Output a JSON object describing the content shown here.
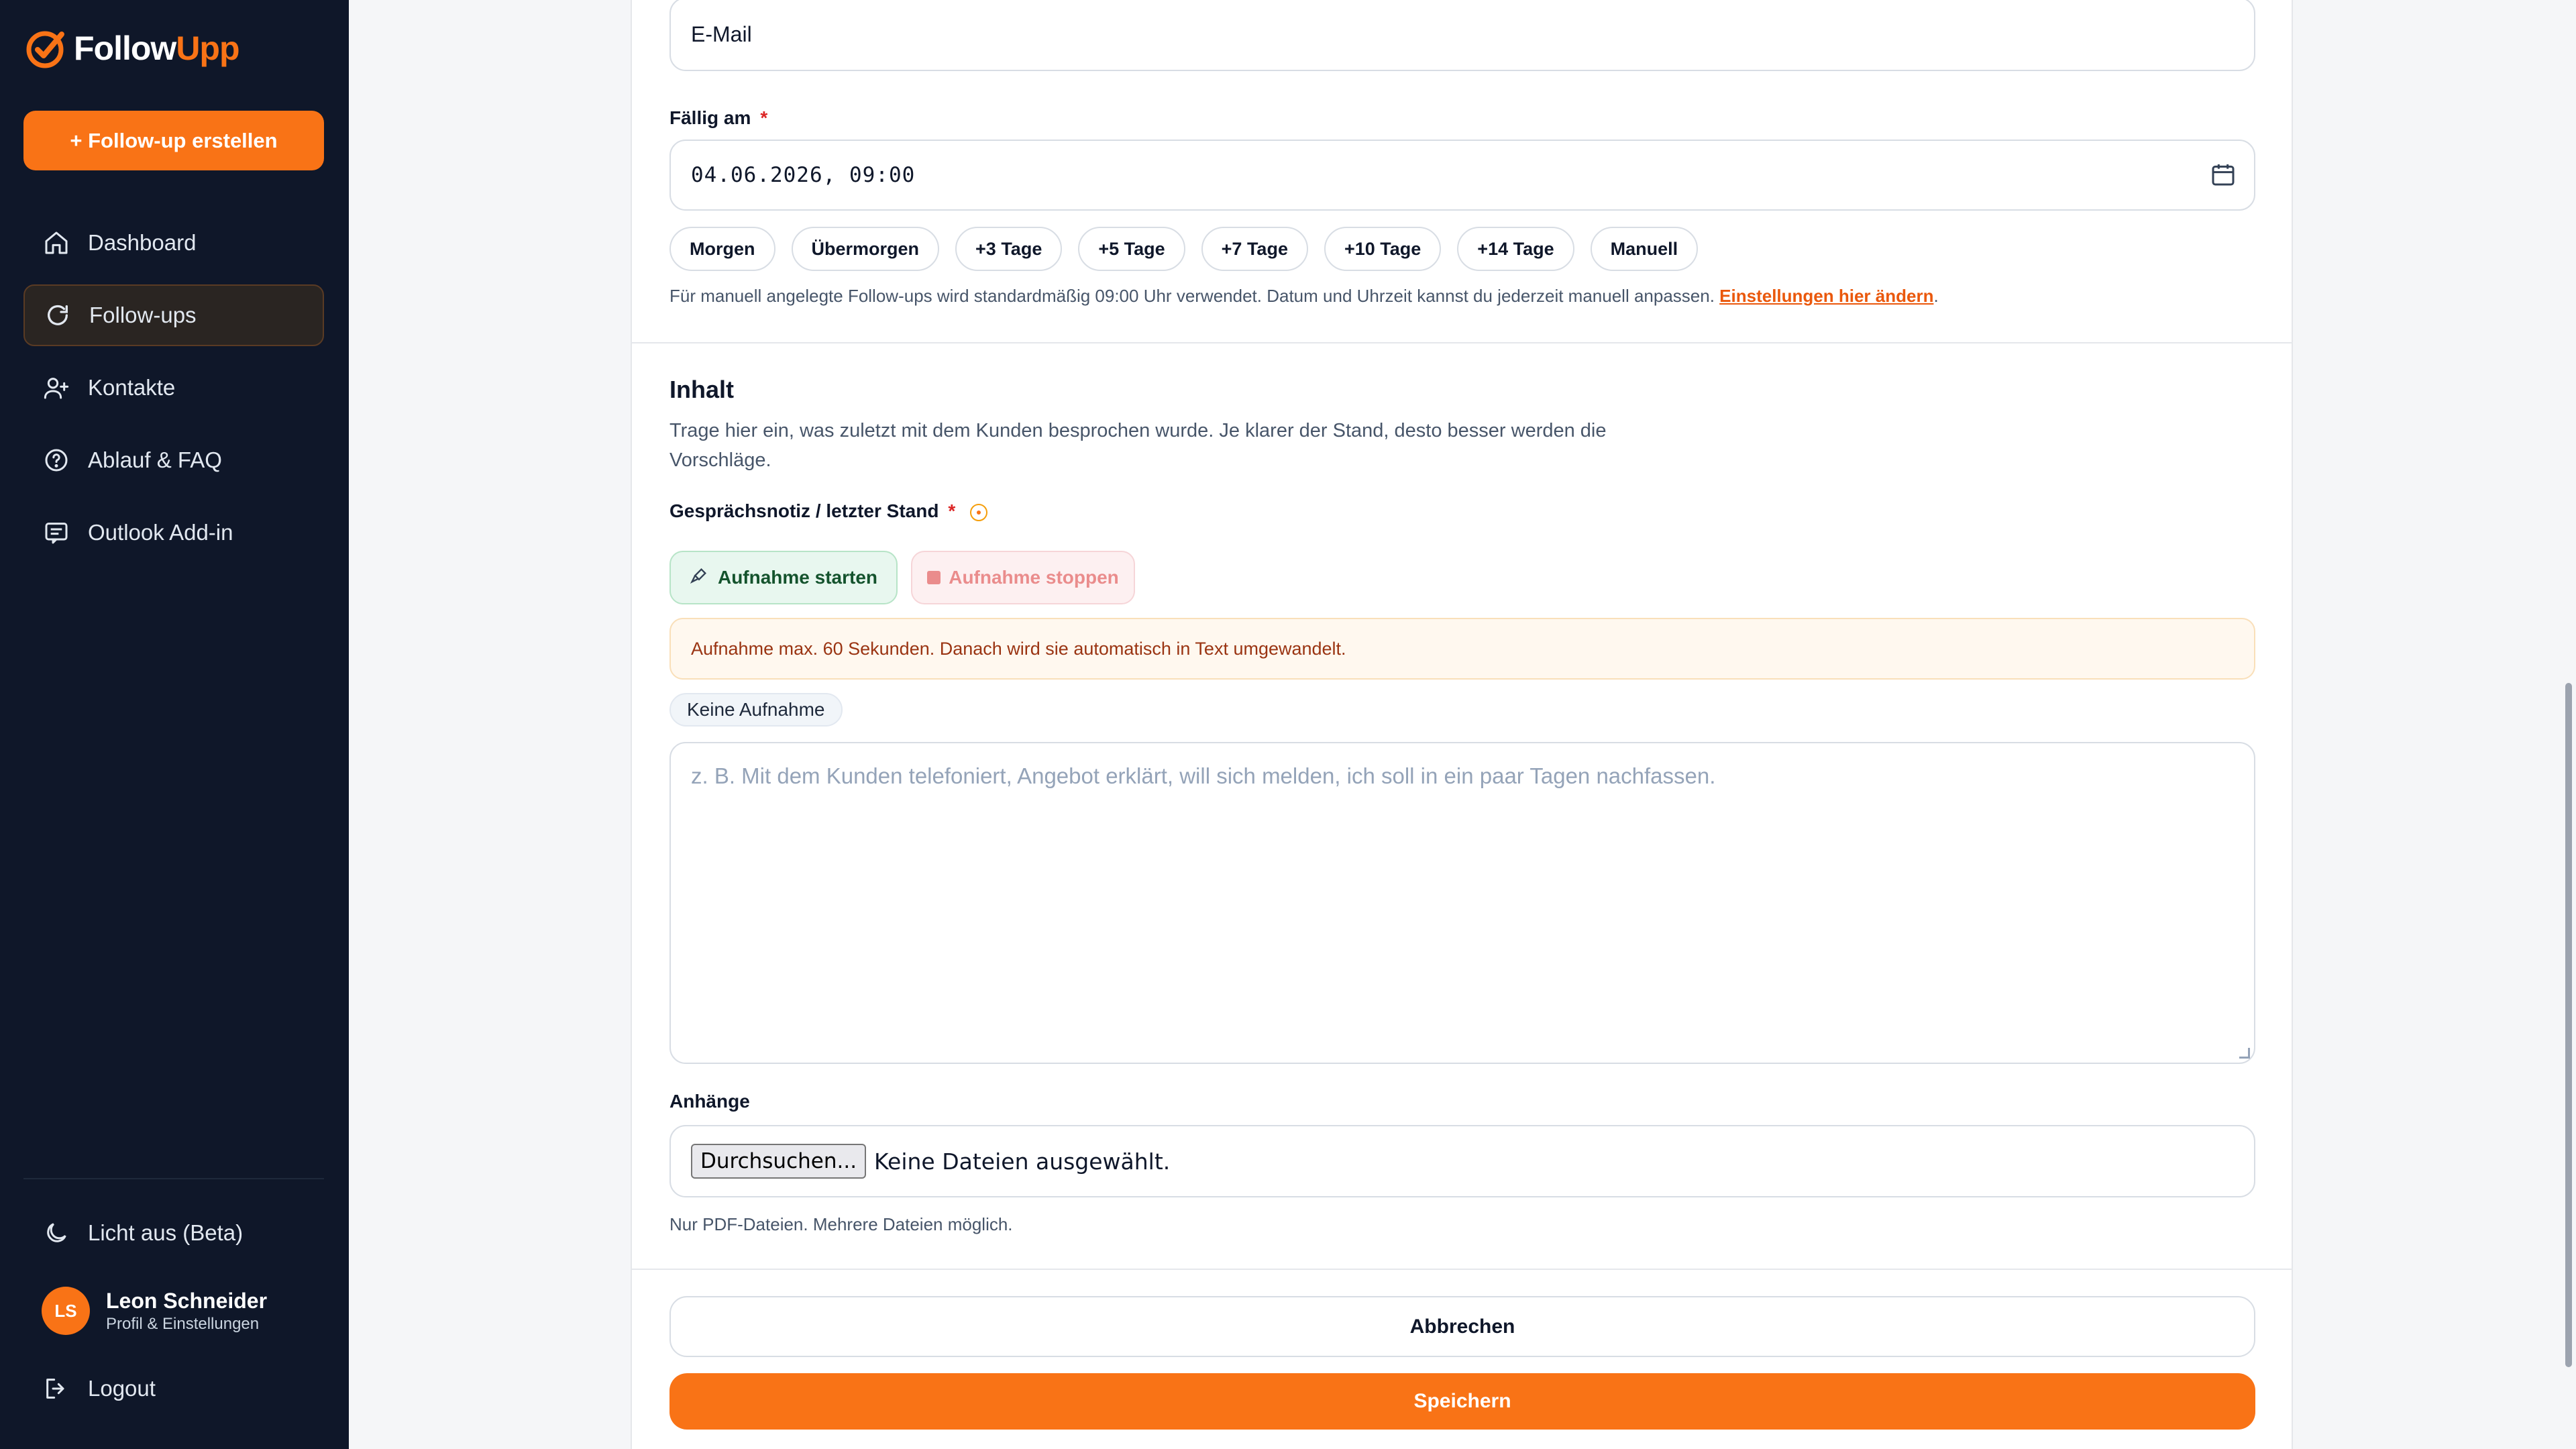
{
  "brand": {
    "name_part1": "Follow",
    "name_part2": "Upp",
    "accent": "#f97316",
    "sidebar_bg": "#0f1729"
  },
  "sidebar": {
    "create_button": "+ Follow-up erstellen",
    "items": [
      {
        "label": "Dashboard",
        "icon": "home-icon",
        "active": false
      },
      {
        "label": "Follow-ups",
        "icon": "refresh-icon",
        "active": true
      },
      {
        "label": "Kontakte",
        "icon": "user-plus-icon",
        "active": false
      },
      {
        "label": "Ablauf & FAQ",
        "icon": "help-circle-icon",
        "active": false
      },
      {
        "label": "Outlook Add-in",
        "icon": "mail-icon",
        "active": false
      }
    ],
    "theme_toggle": "Licht aus (Beta)",
    "profile": {
      "initials": "LS",
      "name": "Leon Schneider",
      "subtitle": "Profil & Einstellungen"
    },
    "logout": "Logout"
  },
  "form": {
    "channel_value": "E-Mail",
    "due": {
      "label": "Fällig am",
      "required_mark": "*",
      "value": "04.06.2026, 09:00",
      "quick_chips": [
        "Morgen",
        "Übermorgen",
        "+3 Tage",
        "+5 Tage",
        "+7 Tage",
        "+10 Tage",
        "+14 Tage",
        "Manuell"
      ],
      "hint_text": "Für manuell angelegte Follow-ups wird standardmäßig 09:00 Uhr verwendet. Datum und Uhrzeit kannst du jederzeit manuell anpassen.",
      "hint_link": "Einstellungen hier ändern",
      "hint_end": "."
    },
    "content": {
      "title": "Inhalt",
      "description": "Trage hier ein, was zuletzt mit dem Kunden besprochen wurde. Je klarer der Stand, desto besser werden die Vorschläge.",
      "note_label": "Gesprächsnotiz / letzter Stand",
      "required_mark": "*",
      "record_start": "Aufnahme starten",
      "record_stop": "Aufnahme stoppen",
      "record_notice": "Aufnahme max. 60 Sekunden. Danach wird sie automatisch in Text umgewandelt.",
      "record_status": "Keine Aufnahme",
      "note_placeholder": "z. B. Mit dem Kunden telefoniert, Angebot erklärt, will sich melden, ich soll in ein paar Tagen nachfassen."
    },
    "attachments": {
      "label": "Anhänge",
      "browse_button": "Durchsuchen...",
      "no_files": "Keine Dateien ausgewählt.",
      "hint": "Nur PDF-Dateien. Mehrere Dateien möglich."
    },
    "actions": {
      "cancel": "Abbrechen",
      "save": "Speichern"
    }
  }
}
